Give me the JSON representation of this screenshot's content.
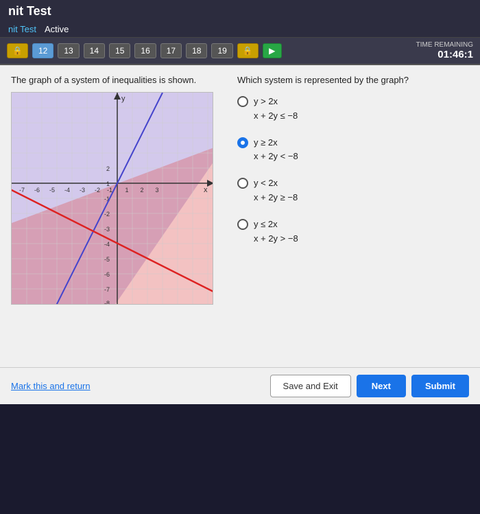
{
  "header": {
    "title": "nit Test"
  },
  "nav": {
    "link1": "nit Test",
    "link2": "Active"
  },
  "toolbar": {
    "buttons": [
      "12",
      "13",
      "14",
      "15",
      "16",
      "17",
      "18",
      "19"
    ],
    "current": "12"
  },
  "timer": {
    "label": "TIME REMAINING",
    "value": "01:46:1"
  },
  "question": {
    "left_text": "The graph of a system of inequalities is shown.",
    "right_text": "Which system is represented by the graph?",
    "options": [
      {
        "id": "A",
        "line1": "y > 2x",
        "line2": "x + 2y ≤ −8",
        "selected": false
      },
      {
        "id": "B",
        "line1": "y ≥ 2x",
        "line2": "x + 2y < −8",
        "selected": true
      },
      {
        "id": "C",
        "line1": "y < 2x",
        "line2": "x + 2y ≥ −8",
        "selected": false
      },
      {
        "id": "D",
        "line1": "y ≤ 2x",
        "line2": "x + 2y > −8",
        "selected": false
      }
    ]
  },
  "buttons": {
    "mark_return": "Mark this and return",
    "save_exit": "Save and Exit",
    "next": "Next",
    "submit": "Submit"
  }
}
